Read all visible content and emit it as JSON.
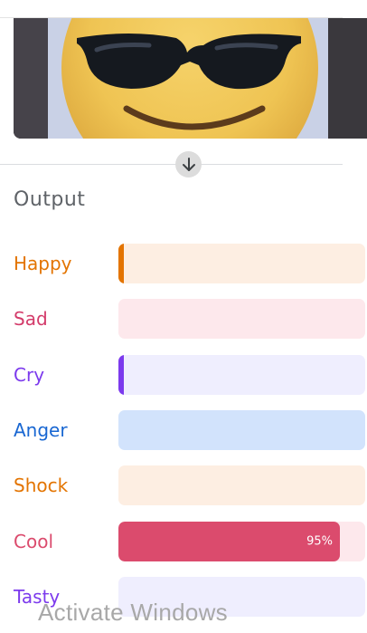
{
  "output": {
    "title": "Output",
    "rows": [
      {
        "label": "Happy",
        "color": "#e37400",
        "track": "#fdeee2",
        "value": 0.02,
        "value_label": ""
      },
      {
        "label": "Sad",
        "color": "#d33b6a",
        "track": "#fde8ec",
        "value": 0.0,
        "value_label": ""
      },
      {
        "label": "Cry",
        "color": "#7c3aed",
        "track": "#efeefe",
        "value": 0.015,
        "value_label": ""
      },
      {
        "label": "Anger",
        "color": "#1967d2",
        "track": "#d2e3fc",
        "value": 0.0,
        "value_label": ""
      },
      {
        "label": "Shock",
        "color": "#e37400",
        "track": "#fdeee2",
        "value": 0.0,
        "value_label": ""
      },
      {
        "label": "Cool",
        "color": "#db4b6d",
        "track": "#fde8ec",
        "value": 0.95,
        "value_label": "95%"
      },
      {
        "label": "Tasty",
        "color": "#7c3aed",
        "track": "#efeefe",
        "value": 0.0,
        "value_label": ""
      }
    ]
  },
  "image": {
    "subject": "sunglasses-emoji"
  },
  "expand_icon": "arrow-down-icon",
  "watermark": "Activate Windows"
}
